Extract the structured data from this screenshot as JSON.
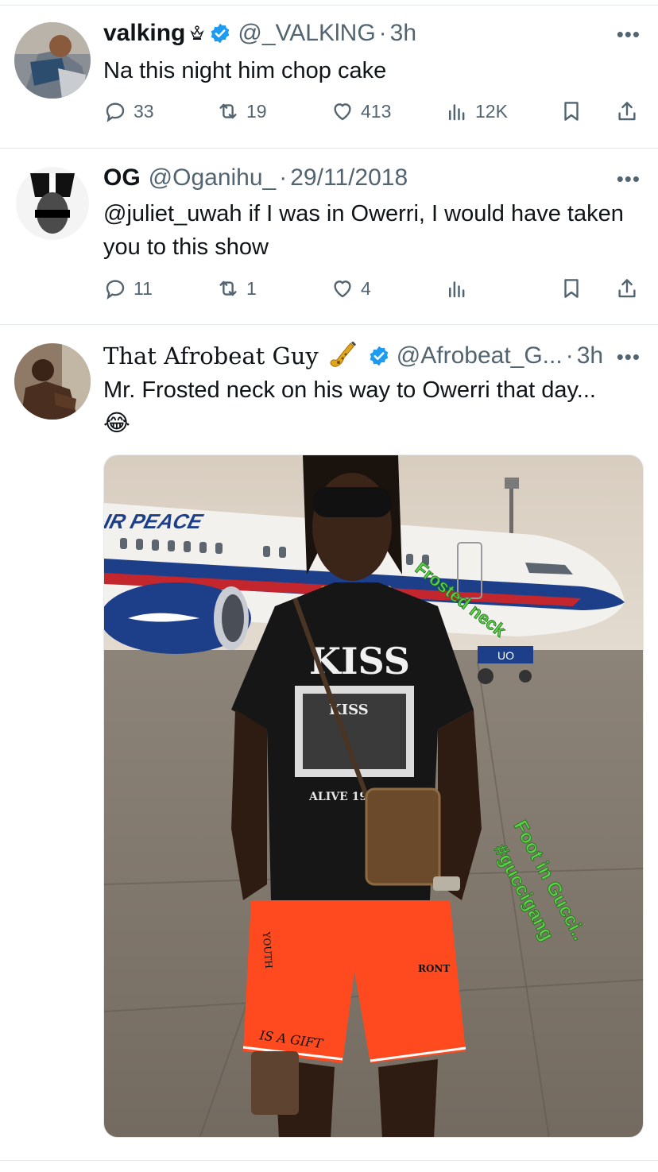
{
  "tweets": [
    {
      "name": "valking",
      "handle": "@_VALKlNG",
      "time": "3h",
      "text": "Na this night him chop cake",
      "replies": "33",
      "retweets": "19",
      "likes": "413",
      "views": "12K"
    },
    {
      "name": "OG",
      "handle": "@Oganihu_",
      "time": "29/11/2018",
      "text": "@juliet_uwah if I was in Owerri, I would have taken you to this show",
      "replies": "11",
      "retweets": "1",
      "likes": "4",
      "views": ""
    },
    {
      "name": "That Afrobeat Guy",
      "handle": "@Afrobeat_G...",
      "time": "3h",
      "text": "Mr. Frosted neck on his way to Owerri that day...😂",
      "media": {
        "airline_text": "AIR PEACE",
        "tail_number": "UO",
        "sticker_1": "Frosted neck",
        "sticker_2": "Foot in Gucci..",
        "sticker_3": "#guccigang",
        "shirt_logo": "KISS",
        "shirt_sub": "KISS",
        "shirt_caption": "ALIVE 1975",
        "shorts_text": "IS A GIFT",
        "shorts_side": "YOUTH",
        "shorts_brand": "RONT"
      }
    }
  ],
  "icons": {
    "reply": "reply-icon",
    "retweet": "retweet-icon",
    "like": "heart-icon",
    "views": "views-icon",
    "bookmark": "bookmark-icon",
    "share": "share-icon",
    "more": "more-icon",
    "verified": "verified-badge-icon"
  },
  "colors": {
    "verified": "#1d9bf0",
    "secondary_text": "#536471",
    "sticker_green": "#5bd24a",
    "shorts_red": "#ff4a1f"
  }
}
